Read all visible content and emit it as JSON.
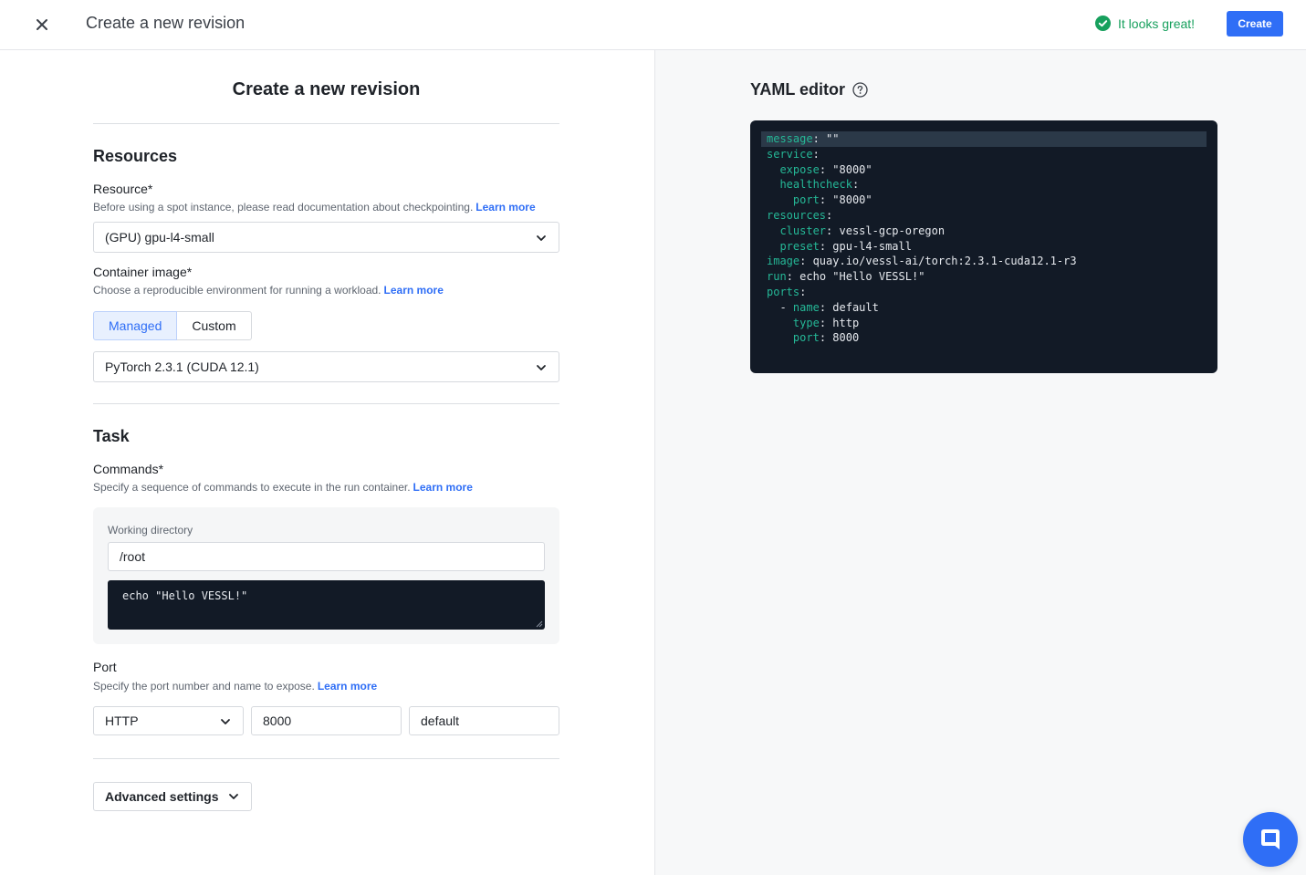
{
  "header": {
    "title": "Create a new revision",
    "status_text": "It looks great!",
    "create_label": "Create"
  },
  "form": {
    "title": "Create a new revision",
    "resources_section": "Resources",
    "resource": {
      "label": "Resource*",
      "help": "Before using a spot instance, please read documentation about checkpointing.",
      "learn_more": "Learn more",
      "value": "(GPU) gpu-l4-small"
    },
    "container_image": {
      "label": "Container image*",
      "help": "Choose a reproducible environment for running a workload.",
      "learn_more": "Learn more",
      "tabs": [
        "Managed",
        "Custom"
      ],
      "selected_tab": "Managed",
      "value": "PyTorch 2.3.1 (CUDA 12.1)"
    },
    "task_section": "Task",
    "commands": {
      "label": "Commands*",
      "help": "Specify a sequence of commands to execute in the run container.",
      "learn_more": "Learn more",
      "working_dir_label": "Working directory",
      "working_dir_value": "/root",
      "command_value": "echo \"Hello VESSL!\""
    },
    "port": {
      "label": "Port",
      "help": "Specify the port number and name to expose.",
      "learn_more": "Learn more",
      "protocol": "HTTP",
      "number": "8000",
      "name": "default"
    },
    "advanced_label": "Advanced settings"
  },
  "yaml": {
    "title": "YAML editor",
    "lines": [
      {
        "indent": "",
        "key": "message",
        "value": " \"\""
      },
      {
        "indent": "",
        "key": "service",
        "value": ""
      },
      {
        "indent": "  ",
        "key": "expose",
        "value": " \"8000\""
      },
      {
        "indent": "  ",
        "key": "healthcheck",
        "value": ""
      },
      {
        "indent": "    ",
        "key": "port",
        "value": " \"8000\""
      },
      {
        "indent": "",
        "key": "resources",
        "value": ""
      },
      {
        "indent": "  ",
        "key": "cluster",
        "value": " vessl-gcp-oregon"
      },
      {
        "indent": "  ",
        "key": "preset",
        "value": " gpu-l4-small"
      },
      {
        "indent": "",
        "key": "image",
        "value": " quay.io/vessl-ai/torch:2.3.1-cuda12.1-r3"
      },
      {
        "indent": "",
        "key": "run",
        "value": " echo \"Hello VESSL!\""
      },
      {
        "indent": "",
        "key": "ports",
        "value": ""
      },
      {
        "indent": "  - ",
        "key": "name",
        "value": " default"
      },
      {
        "indent": "    ",
        "key": "type",
        "value": " http"
      },
      {
        "indent": "    ",
        "key": "port",
        "value": " 8000"
      }
    ]
  },
  "colors": {
    "accent": "#2f6ef6",
    "success": "#17a05d",
    "editor_bg": "#121a26",
    "yaml_key": "#25b897"
  }
}
